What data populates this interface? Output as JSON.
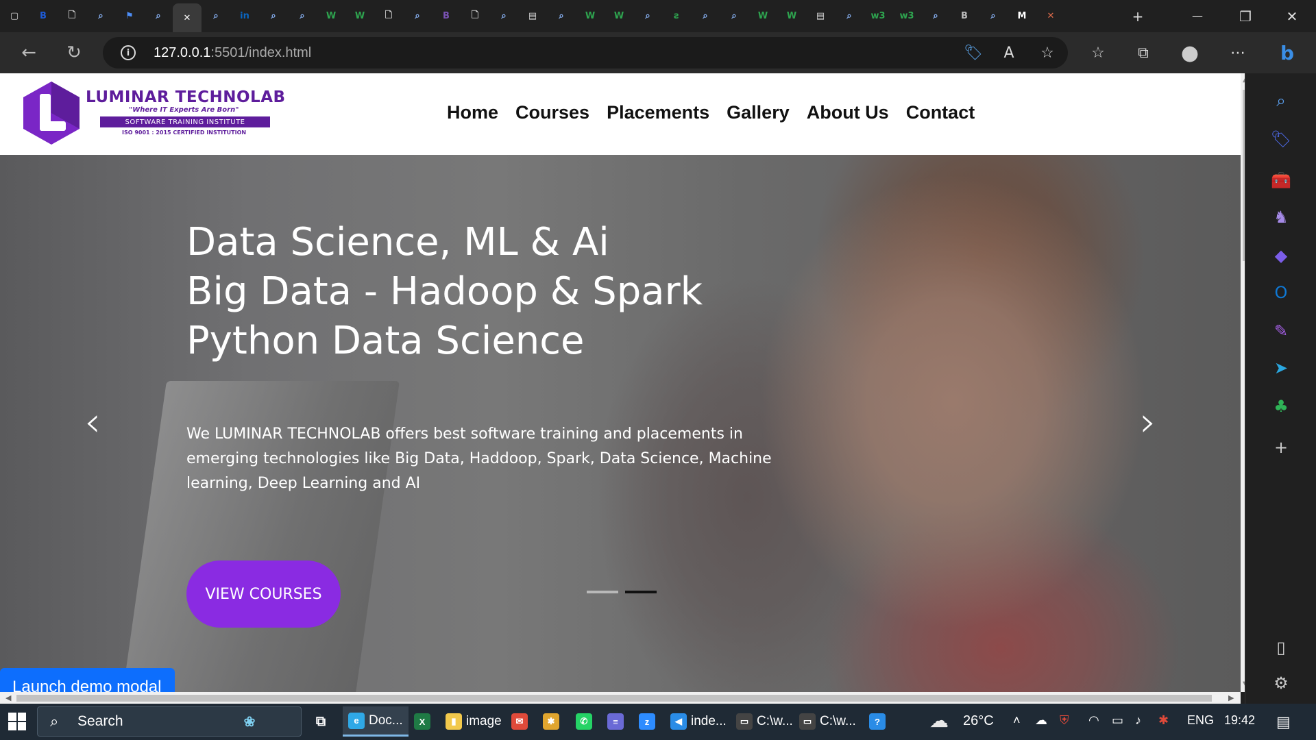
{
  "browser": {
    "tabs": [
      {
        "icon": "window-icon",
        "glyph": "▢",
        "color": "#cfcfcf"
      },
      {
        "icon": "bing-b-icon",
        "glyph": "B",
        "color": "#1e5bd6"
      },
      {
        "icon": "document-icon",
        "glyph": "🗋",
        "color": "#cfcfcf"
      },
      {
        "icon": "search-icon",
        "glyph": "⌕",
        "color": "#8ab4f8"
      },
      {
        "icon": "flag-icon",
        "glyph": "⚑",
        "color": "#4d8ef7"
      },
      {
        "icon": "search-icon",
        "glyph": "⌕",
        "color": "#8ab4f8"
      },
      {
        "icon": "close-icon",
        "glyph": "✕",
        "color": "#ffffff",
        "active": true
      },
      {
        "icon": "search-icon",
        "glyph": "⌕",
        "color": "#8ab4f8"
      },
      {
        "icon": "linkedin-icon",
        "glyph": "in",
        "color": "#0a66c2"
      },
      {
        "icon": "search-icon",
        "glyph": "⌕",
        "color": "#8ab4f8"
      },
      {
        "icon": "search-icon",
        "glyph": "⌕",
        "color": "#8ab4f8"
      },
      {
        "icon": "w-icon",
        "glyph": "W",
        "color": "#2ea44f"
      },
      {
        "icon": "w-icon",
        "glyph": "W",
        "color": "#2ea44f"
      },
      {
        "icon": "document-icon",
        "glyph": "🗋",
        "color": "#cfcfcf"
      },
      {
        "icon": "search-icon",
        "glyph": "⌕",
        "color": "#8ab4f8"
      },
      {
        "icon": "bootstrap-icon",
        "glyph": "B",
        "color": "#7952b3"
      },
      {
        "icon": "document-icon",
        "glyph": "🗋",
        "color": "#cfcfcf"
      },
      {
        "icon": "search-icon",
        "glyph": "⌕",
        "color": "#8ab4f8"
      },
      {
        "icon": "calendar-icon",
        "glyph": "▤",
        "color": "#cfcfcf"
      },
      {
        "icon": "search-icon",
        "glyph": "⌕",
        "color": "#8ab4f8"
      },
      {
        "icon": "w-icon",
        "glyph": "W",
        "color": "#2ea44f"
      },
      {
        "icon": "w-icon",
        "glyph": "W",
        "color": "#2ea44f"
      },
      {
        "icon": "search-icon",
        "glyph": "⌕",
        "color": "#8ab4f8"
      },
      {
        "icon": "strike-icon",
        "glyph": "ƨ",
        "color": "#2ea44f"
      },
      {
        "icon": "search-icon",
        "glyph": "⌕",
        "color": "#8ab4f8"
      },
      {
        "icon": "search-icon",
        "glyph": "⌕",
        "color": "#8ab4f8"
      },
      {
        "icon": "w-icon",
        "glyph": "W",
        "color": "#2ea44f"
      },
      {
        "icon": "w-icon",
        "glyph": "W",
        "color": "#2ea44f"
      },
      {
        "icon": "calendar-icon",
        "glyph": "▤",
        "color": "#cfcfcf"
      },
      {
        "icon": "search-icon",
        "glyph": "⌕",
        "color": "#8ab4f8"
      },
      {
        "icon": "w3-icon",
        "glyph": "w3",
        "color": "#2ea44f"
      },
      {
        "icon": "w3-icon",
        "glyph": "w3",
        "color": "#2ea44f"
      },
      {
        "icon": "search-icon",
        "glyph": "⌕",
        "color": "#8ab4f8"
      },
      {
        "icon": "bootstrap-icon",
        "glyph": "B",
        "color": "#bbbbbb"
      },
      {
        "icon": "search-icon",
        "glyph": "⌕",
        "color": "#8ab4f8"
      },
      {
        "icon": "medium-icon",
        "glyph": "M",
        "color": "#ffffff"
      },
      {
        "icon": "app-icon",
        "glyph": "✕",
        "color": "#e06c4c"
      }
    ],
    "new_tab_glyph": "+",
    "minimize_glyph": "—",
    "restore_glyph": "❐",
    "close_glyph": "✕",
    "back_glyph": "←",
    "reload_glyph": "↻",
    "url_host": "127.0.0.1",
    "url_rest": ":5501/index.html",
    "info_glyph": "i",
    "address_icons": [
      {
        "name": "coupon-icon",
        "glyph": "🏷",
        "color": "#5ba3e8"
      },
      {
        "name": "read-aloud-icon",
        "glyph": "A",
        "color": "#dddddd"
      },
      {
        "name": "add-favorite-icon",
        "glyph": "☆",
        "color": "#dddddd"
      }
    ],
    "toolbar_icons": [
      {
        "name": "favorites-icon",
        "glyph": "☆",
        "color": "#dddddd"
      },
      {
        "name": "collections-icon",
        "glyph": "⧉",
        "color": "#dddddd"
      },
      {
        "name": "profile-icon",
        "glyph": "●",
        "color": "#cccccc"
      },
      {
        "name": "more-icon",
        "glyph": "⋯",
        "color": "#dddddd"
      },
      {
        "name": "bing-icon",
        "glyph": "b",
        "color": "#3a8ee6"
      }
    ],
    "sidebar_icons": [
      {
        "name": "search-icon",
        "glyph": "⌕",
        "color": "#5aa0f0"
      },
      {
        "name": "shopping-tag-icon",
        "glyph": "🏷",
        "color": "#4d6ae8"
      },
      {
        "name": "tools-icon",
        "glyph": "🧰",
        "color": "#e0463a"
      },
      {
        "name": "games-icon",
        "glyph": "♞",
        "color": "#a58ae6"
      },
      {
        "name": "microsoft-365-icon",
        "glyph": "◆",
        "color": "#7b5de8"
      },
      {
        "name": "outlook-icon",
        "glyph": "O",
        "color": "#0f78d4"
      },
      {
        "name": "designer-icon",
        "glyph": "✎",
        "color": "#a55fe6"
      },
      {
        "name": "send-icon",
        "glyph": "➤",
        "color": "#2aa7e0"
      },
      {
        "name": "tree-icon",
        "glyph": "♣",
        "color": "#2fb457"
      },
      {
        "name": "add-icon",
        "glyph": "+",
        "color": "#cccccc"
      },
      {
        "name": "split-view-icon",
        "glyph": "▯",
        "color": "#cccccc"
      },
      {
        "name": "settings-icon",
        "glyph": "⚙",
        "color": "#cccccc"
      }
    ]
  },
  "site": {
    "brand": "LUMINAR TECHNOLAB",
    "tagline": "\"Where IT Experts Are Born\"",
    "band": "SOFTWARE TRAINING INSTITUTE",
    "iso": "ISO 9001 : 2015 CERTIFIED INSTITUTION",
    "logo_letter": "L",
    "brand_color": "#5e1d9c",
    "menu": [
      "Home",
      "Courses",
      "Placements",
      "Gallery",
      "About Us",
      "Contact"
    ],
    "hero": {
      "lines": [
        "Data Science, ML & Ai",
        "Big Data - Hadoop & Spark",
        "Python Data Science"
      ],
      "description": "We LUMINAR TECHNOLAB offers best software training and placements in emerging technologies like Big Data, Haddoop, Spark, Data Science, Machine learning, Deep Learning and AI",
      "button": "VIEW COURSES",
      "button_color": "#8a2be2",
      "prev_glyph": "‹",
      "next_glyph": "›",
      "slides": 2,
      "active_slide": 2
    },
    "demo_button": "Launch demo modal"
  },
  "taskbar": {
    "search": "Search",
    "apps": [
      {
        "name": "edge-app",
        "label": "Doc...",
        "glyph": "e",
        "color": "#2fa8e6",
        "active": true
      },
      {
        "name": "excel-app",
        "label": "",
        "glyph": "X",
        "color": "#1f7a45"
      },
      {
        "name": "file-explorer-app",
        "label": "image",
        "glyph": "▮",
        "color": "#f2c94c"
      },
      {
        "name": "mail-app",
        "label": "",
        "glyph": "✉",
        "color": "#e04a3a"
      },
      {
        "name": "slack-app",
        "label": "",
        "glyph": "✱",
        "color": "#e0a52e"
      },
      {
        "name": "whatsapp-app",
        "label": "",
        "glyph": "✆",
        "color": "#25d366"
      },
      {
        "name": "teams-app",
        "label": "",
        "glyph": "≡",
        "color": "#6a6ad6"
      },
      {
        "name": "zoom-app",
        "label": "",
        "glyph": "z",
        "color": "#2d8cff"
      },
      {
        "name": "vscode-app",
        "label": "inde...",
        "glyph": "◀",
        "color": "#2a8ce6"
      },
      {
        "name": "cmd-app-1",
        "label": "C:\\w...",
        "glyph": "▭",
        "color": "#444444"
      },
      {
        "name": "cmd-app-2",
        "label": "C:\\w...",
        "glyph": "▭",
        "color": "#444444"
      },
      {
        "name": "help-app",
        "label": "",
        "glyph": "?",
        "color": "#2a8ce6"
      }
    ],
    "weather": "26°C",
    "language": "ENG",
    "time": "19:42"
  }
}
